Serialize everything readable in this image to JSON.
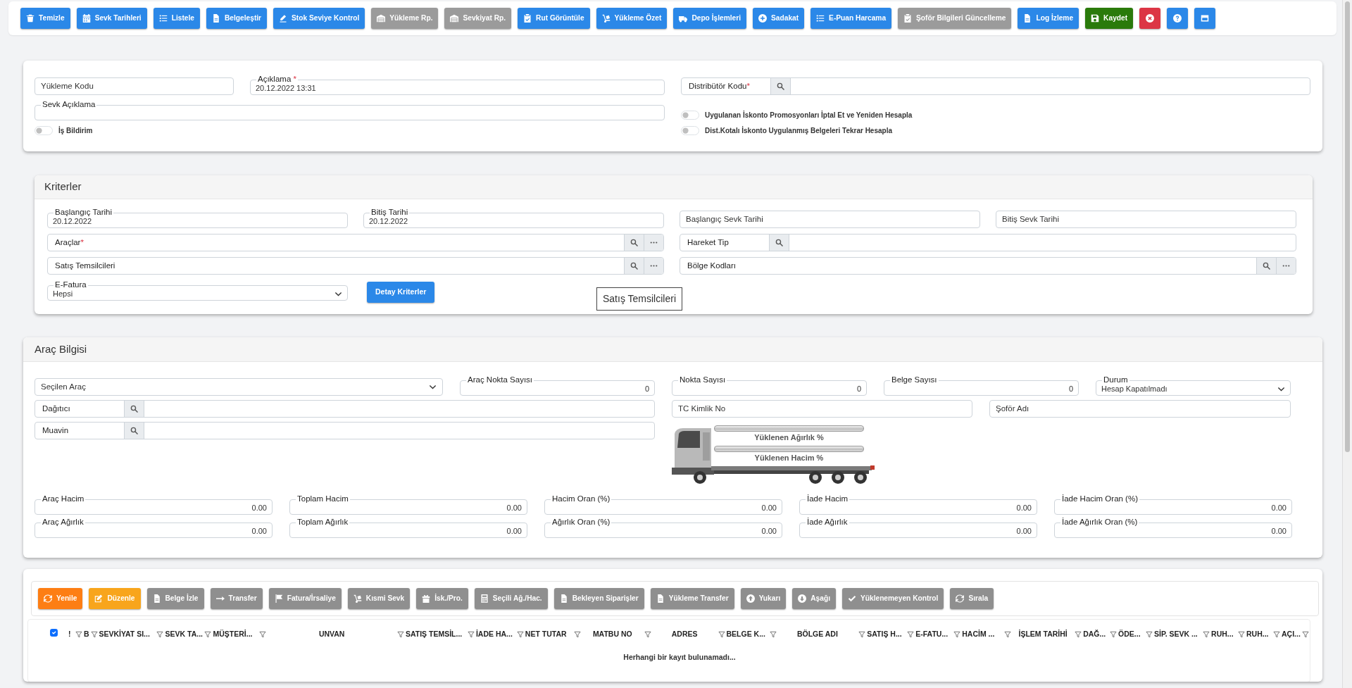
{
  "toolbar": [
    {
      "label": "Temizle",
      "color": "#2b88e8"
    },
    {
      "label": "Sevk Tarihleri",
      "color": "#2b88e8"
    },
    {
      "label": "Listele",
      "color": "#2b88e8"
    },
    {
      "label": "Belgeleştir",
      "color": "#2b88e8"
    },
    {
      "label": "Stok Seviye Kontrol",
      "color": "#2b88e8"
    },
    {
      "label": "Yükleme Rp.",
      "color": "#9b9b9b"
    },
    {
      "label": "Sevkiyat Rp.",
      "color": "#9b9b9b"
    },
    {
      "label": "Rut Görüntüle",
      "color": "#2b88e8"
    },
    {
      "label": "Yükleme Özet",
      "color": "#2b88e8"
    },
    {
      "label": "Depo İşlemleri",
      "color": "#2b88e8"
    },
    {
      "label": "Sadakat",
      "color": "#2b88e8"
    },
    {
      "label": "E-Puan Harcama",
      "color": "#2b88e8"
    },
    {
      "label": "Şoför Bilgileri Güncelleme",
      "color": "#9b9b9b"
    },
    {
      "label": "Log İzleme",
      "color": "#2b88e8"
    },
    {
      "label": "Kaydet",
      "color": "#2a7a0b"
    },
    {
      "color": "#dc3545"
    },
    {
      "color": "#2b88e8"
    },
    {
      "color": "#2b88e8"
    }
  ],
  "main_form": {
    "items": [
      {
        "kind": "inside",
        "label": "Yükleme Kodu"
      },
      {
        "kind": "floating",
        "label": "Açıklama",
        "mark": "*",
        "value": "20.12.2022 13:31"
      },
      {
        "kind": "lookup",
        "label": "Distribütör Kodu",
        "mark": "*"
      },
      {
        "kind": "floating",
        "label": "Sevk Açıklama"
      },
      {
        "kind": "toggle",
        "label": "Uygulanan İskonto Promosyonları İptal Et ve Yeniden Hesapla",
        "on": false
      },
      {
        "kind": "toggle",
        "label": "İş Bildirim",
        "on": false
      },
      {
        "kind": "toggle",
        "label": "Dist.Kotalı İskonto Uygulanmış Belgeleri Tekrar Hesapla",
        "on": false
      }
    ]
  },
  "criteria": {
    "title": "Kriterler",
    "items": [
      {
        "kind": "floating",
        "label": "Başlangıç Tarihi",
        "value": "20.12.2022"
      },
      {
        "kind": "floating",
        "label": "Bitiş Tarihi",
        "value": "20.12.2022"
      },
      {
        "kind": "inside",
        "label": "Başlangıç Sevk Tarihi"
      },
      {
        "kind": "inside",
        "label": "Bitiş Sevk Tarihi"
      },
      {
        "kind": "picker",
        "label": "Araçlar",
        "mark": "*"
      },
      {
        "kind": "lookup",
        "label": "Hareket Tip"
      },
      {
        "kind": "picker",
        "label": "Satış Temsilcileri"
      },
      {
        "kind": "picker",
        "label": "Bölge Kodları"
      },
      {
        "kind": "select",
        "label": "E-Fatura",
        "value": "Hepsi"
      },
      {
        "kind": "button",
        "label": "Detay Kriterler"
      }
    ],
    "tooltip": "Satış Temsilcileri"
  },
  "vehicle": {
    "title": "Araç Bilgisi",
    "items": [
      {
        "kind": "select",
        "placeholder": "Seçilen Araç"
      },
      {
        "kind": "number",
        "label": "Araç Nokta Sayısı",
        "value": "0"
      },
      {
        "kind": "number",
        "label": "Nokta Sayısı",
        "value": "0"
      },
      {
        "kind": "number",
        "label": "Belge Sayısı",
        "value": "0"
      },
      {
        "kind": "select",
        "label": "Durum",
        "value": "Hesap Kapatılmadı"
      },
      {
        "kind": "lookup",
        "label": "Dağıtıcı"
      },
      {
        "kind": "inside",
        "label": "TC Kimlik No"
      },
      {
        "kind": "inside",
        "label": "Şoför Adı"
      },
      {
        "kind": "lookup",
        "label": "Muavin"
      }
    ],
    "load_meters": [
      {
        "label": "Yüklenen Ağırlık %",
        "level": 0
      },
      {
        "label": "Yüklenen Hacim %",
        "level": 0
      }
    ],
    "totals": [
      {
        "kind": "number",
        "label": "Araç Hacim",
        "value": "0.00"
      },
      {
        "kind": "number",
        "label": "Toplam Hacim",
        "value": "0.00"
      },
      {
        "kind": "number",
        "label": "Hacim Oran (%)",
        "value": "0.00"
      },
      {
        "kind": "number",
        "label": "İade Hacim",
        "value": "0.00"
      },
      {
        "kind": "number",
        "label": "İade Hacim Oran (%)",
        "value": "0.00"
      },
      {
        "kind": "number",
        "label": "Araç Ağırlık",
        "value": "0.00"
      },
      {
        "kind": "number",
        "label": "Toplam Ağırlık",
        "value": "0.00"
      },
      {
        "kind": "number",
        "label": "Ağırlık Oran (%)",
        "value": "0.00"
      },
      {
        "kind": "number",
        "label": "İade Ağırlık",
        "value": "0.00"
      },
      {
        "kind": "number",
        "label": "İade Ağırlık Oran (%)",
        "value": "0.00"
      }
    ]
  },
  "documents": {
    "toolbar": [
      {
        "label": "Yenile",
        "color": "#fd7e14"
      },
      {
        "label": "Düzenle",
        "color": "#f8a51c"
      },
      {
        "label": "Belge İzle",
        "color": "#8f8f8f"
      },
      {
        "label": "Transfer",
        "color": "#8f8f8f"
      },
      {
        "label": "Fatura/İrsaliye",
        "color": "#8f8f8f"
      },
      {
        "label": "Kısmi Sevk",
        "color": "#8f8f8f"
      },
      {
        "label": "İsk./Pro.",
        "color": "#8f8f8f"
      },
      {
        "label": "Seçili Ağ./Hac.",
        "color": "#8f8f8f"
      },
      {
        "label": "Bekleyen Siparişler",
        "color": "#8f8f8f"
      },
      {
        "label": "Yükleme Transfer",
        "color": "#8f8f8f"
      },
      {
        "label": "Yukarı",
        "color": "#8f8f8f"
      },
      {
        "label": "Aşağı",
        "color": "#8f8f8f"
      },
      {
        "label": "Yüklenemeyen Kontrol",
        "color": "#8f8f8f"
      },
      {
        "label": "Sırala",
        "color": "#8f8f8f"
      }
    ],
    "select_all": {
      "checked": true
    },
    "columns": [
      "!",
      "B",
      "SEVKİYAT SI...",
      "SEVK TA...",
      "MÜŞTERİ...",
      "UNVAN",
      "SATIŞ TEMSİL...",
      "İADE HA...",
      "NET TUTAR",
      "MATBU NO",
      "ADRES",
      "BELGE K...",
      "BÖLGE ADI",
      "SATIŞ H...",
      "E-FATU...",
      "HACİM ...",
      "İŞLEM TARİHİ",
      "DAĞ...",
      "ÖDE...",
      "SİP. SEVK ...",
      "RUH...",
      "RUH...",
      "AÇI..."
    ],
    "empty_text": "Herhangi bir kayıt bulunamadı..."
  }
}
